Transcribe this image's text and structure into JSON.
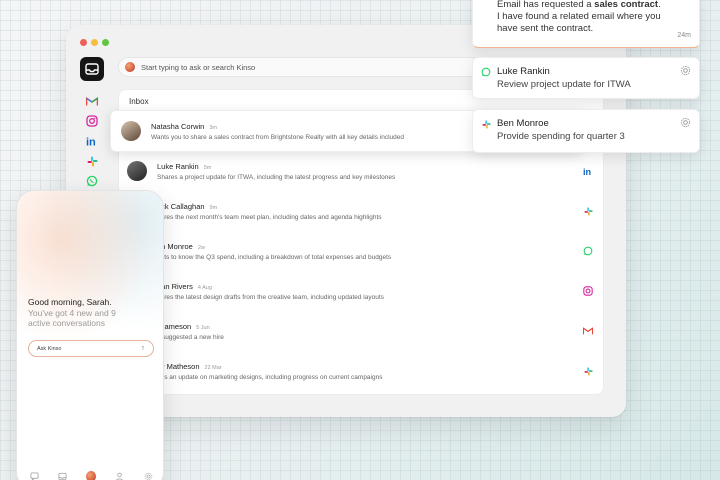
{
  "search": {
    "placeholder": "Start typing to ask or search Kinso"
  },
  "inbox": {
    "title": "Inbox",
    "messages": [
      {
        "name": "Natasha Corwin",
        "time": "3m",
        "text": "Wants you to share a sales contract from Brightstone Realty with all key details included",
        "channel": "none"
      },
      {
        "name": "Luke Rankin",
        "time": "5m",
        "text": "Shares a project update for ITWA, including the latest progress and key milestones",
        "channel": "linkedin"
      },
      {
        "name": "ack Callaghan",
        "time": "9m",
        "text": "hares the next month's team meet plan, including dates and agenda highlights",
        "channel": "slack"
      },
      {
        "name": "en Monroe",
        "time": "2w",
        "text": "ants to know the Q3 spend, including a breakdown of total expenses and budgets",
        "channel": "whatsapp"
      },
      {
        "name": "han Rivers",
        "time": "4 Aug",
        "text": "hares the latest design drafts from the creative team, including updated layouts",
        "channel": "instagram"
      },
      {
        "name": "l Jameson",
        "time": "5 Jun",
        "text": "s suggested a new hire",
        "channel": "gmail"
      },
      {
        "name": "cy Matheson",
        "time": "22 Mar",
        "text": "eds an update on marketing designs, including progress on current campaigns",
        "channel": "slack"
      }
    ]
  },
  "notifications": {
    "top": {
      "line1_pre": "Email has requested a ",
      "line1_bold": "sales contract",
      "line1_post": ".",
      "line2": "I have found a related email where you have sent the contract.",
      "age": "24m"
    },
    "luke": {
      "name": "Luke Rankin",
      "text": "Review project update for ITWA",
      "channel": "whatsapp"
    },
    "ben": {
      "name": "Ben Monroe",
      "text": "Provide spending for quarter 3",
      "channel": "slack"
    }
  },
  "phone": {
    "greeting": "Good morning, Sarah.",
    "subtitle": "You've got 4 new and 9 active conversations",
    "ask_placeholder": "Ask Kinso",
    "ask_arrow": "↑"
  },
  "colors": {
    "accent": "#e3b39c",
    "gmail": "#ea4335",
    "linkedin": "#0a66c2",
    "whatsapp": "#25d366",
    "instagram": "#d6249f",
    "slack": "#e01e5a"
  }
}
